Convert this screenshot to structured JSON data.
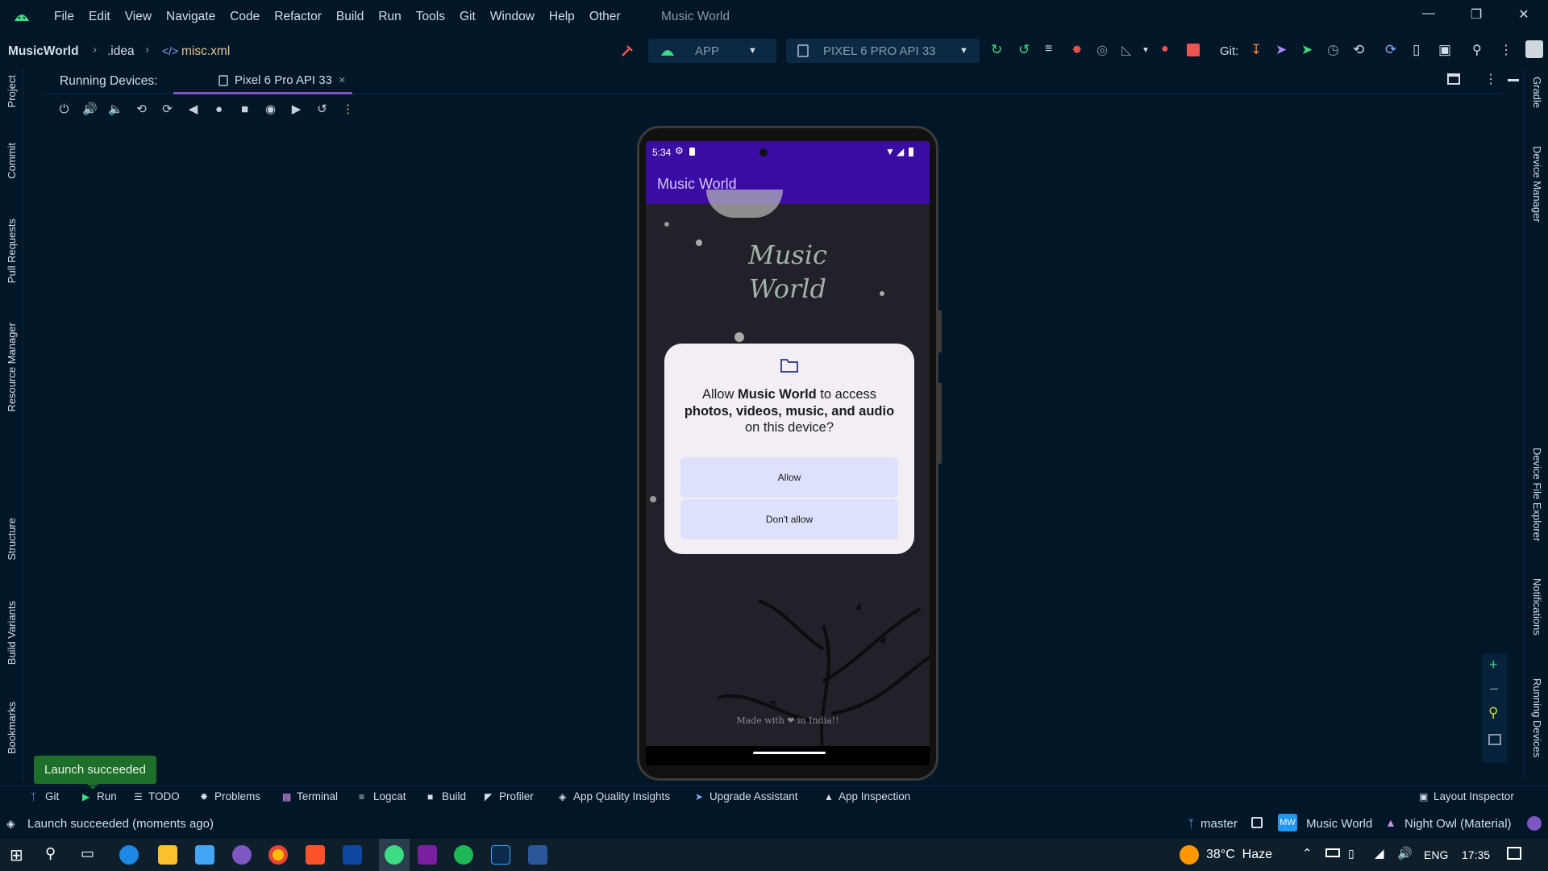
{
  "menubar": {
    "items": [
      "File",
      "Edit",
      "View",
      "Navigate",
      "Code",
      "Refactor",
      "Build",
      "Run",
      "Tools",
      "Git",
      "Window",
      "Help",
      "Other"
    ],
    "window_title": "Music World"
  },
  "navbar": {
    "project": "MusicWorld",
    "crumb1": ".idea",
    "crumb2": "misc.xml",
    "run_config": "APP",
    "device": "PIXEL 6 PRO API 33",
    "git_label": "Git:"
  },
  "running_devices": {
    "label": "Running Devices:",
    "tab": "Pixel 6 Pro API 33",
    "tab_close": "×"
  },
  "left_strip": [
    "Project",
    "Commit",
    "Pull Requests",
    "Resource Manager",
    "Structure",
    "Build Variants",
    "Bookmarks"
  ],
  "right_strip": [
    "Gradle",
    "Device Manager",
    "Device File Explorer",
    "Notifications",
    "Running Devices"
  ],
  "phone": {
    "time": "5:34",
    "app_title": "Music World",
    "bg_title_line1": "Music",
    "bg_title_line2": "World",
    "footer": "Made with ❤ in India!!",
    "dialog": {
      "prefix": "Allow ",
      "app": "Music World",
      "mid": " to access",
      "bold_line": "photos, videos, music, and audio",
      "suffix": "on this device?",
      "allow": "Allow",
      "deny": "Don't allow"
    }
  },
  "toast": "Launch succeeded",
  "bottom_tools": [
    "Git",
    "Run",
    "TODO",
    "Problems",
    "Terminal",
    "Logcat",
    "Build",
    "Profiler",
    "App Quality Insights",
    "Upgrade Assistant",
    "App Inspection"
  ],
  "layout_inspector": "Layout Inspector",
  "status": {
    "message": "Launch succeeded (moments ago)",
    "branch": "master",
    "project_badge": "MW",
    "project": "Music World",
    "theme": "Night Owl (Material)"
  },
  "taskbar": {
    "weather": "38°C  Haze",
    "lang": "ENG",
    "time": "17:35"
  },
  "colors": {
    "background": "#011627",
    "accent": "#7e57c2",
    "app_bar": "#3a0ca3",
    "toast": "#1e6f2a",
    "stop": "#ef5350"
  }
}
